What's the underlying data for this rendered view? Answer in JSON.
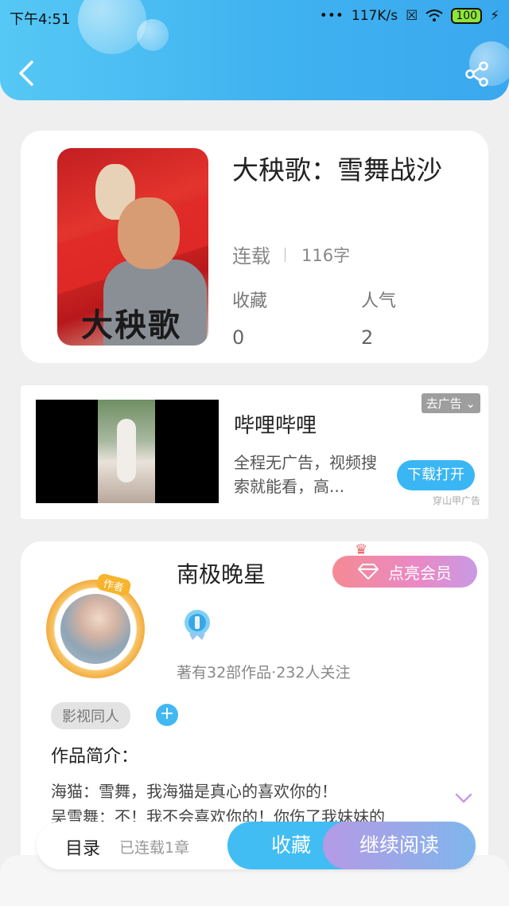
{
  "status_bar": {
    "time": "下午4:51",
    "network_speed": "117K/s",
    "battery": "100"
  },
  "header": {
    "back_icon": "chevron-left-icon",
    "share_icon": "share-icon"
  },
  "book": {
    "title": "大秧歌：雪舞战沙",
    "cover_text": "大秧歌",
    "status": "连载",
    "word_count": "116字",
    "favorites_label": "收藏",
    "favorites_value": "0",
    "popularity_label": "人气",
    "popularity_value": "2"
  },
  "ad": {
    "app_name": "哔哩哔哩",
    "description": "全程无广告，视频搜索就能看，高...",
    "close_label": "去广告",
    "action_label": "下载打开",
    "source": "穿山甲广告"
  },
  "author": {
    "name": "南极晚星",
    "avatar_tag": "作者",
    "vip_button": "点亮会员",
    "stats": "著有32部作品·232人关注",
    "tag": "影视同人",
    "intro_label": "作品简介：",
    "intro_text": "海猫：雪舞，我海猫是真心的喜欢你的！\n吴雪舞：不！我不会喜欢你的！你伤了我妹妹的"
  },
  "bottom_bar": {
    "toc_label": "目录",
    "toc_status": "已连载1章",
    "collect_label": "收藏",
    "read_label": "继续阅读"
  },
  "colors": {
    "accent": "#41bdf3",
    "vip_gradient_start": "#f58a93",
    "read_gradient_start": "#b59ae6"
  }
}
